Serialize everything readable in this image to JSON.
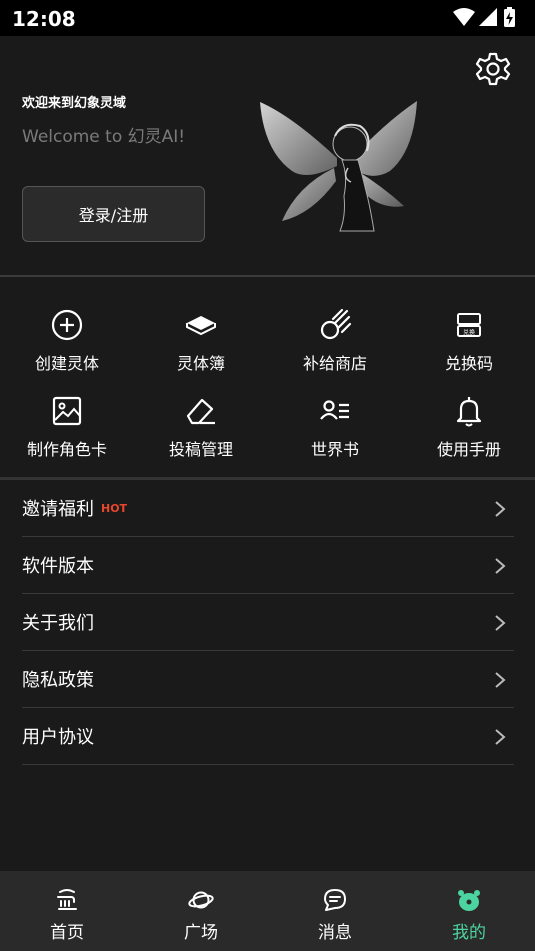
{
  "status_bar": {
    "time": "12:08"
  },
  "profile": {
    "welcome_cn": "欢迎来到幻象灵域",
    "welcome_en": "Welcome to 幻灵AI!",
    "login_label": "登录/注册"
  },
  "grid": {
    "items": [
      {
        "label": "创建灵体",
        "icon": "plus-circle-icon"
      },
      {
        "label": "灵体簿",
        "icon": "book-icon"
      },
      {
        "label": "补给商店",
        "icon": "meteor-icon"
      },
      {
        "label": "兑换码",
        "icon": "redeem-ticket-icon"
      },
      {
        "label": "制作角色卡",
        "icon": "image-card-icon"
      },
      {
        "label": "投稿管理",
        "icon": "eraser-icon"
      },
      {
        "label": "世界书",
        "icon": "user-list-icon"
      },
      {
        "label": "使用手册",
        "icon": "bell-icon"
      }
    ],
    "redeem_icon_text": "兑换"
  },
  "menu": {
    "items": [
      {
        "label": "邀请福利",
        "badge": "HOT"
      },
      {
        "label": "软件版本"
      },
      {
        "label": "关于我们"
      },
      {
        "label": "隐私政策"
      },
      {
        "label": "用户协议"
      }
    ]
  },
  "tabbar": {
    "items": [
      {
        "label": "首页",
        "icon": "home-icon"
      },
      {
        "label": "广场",
        "icon": "planet-icon"
      },
      {
        "label": "消息",
        "icon": "message-icon"
      },
      {
        "label": "我的",
        "icon": "profile-mascot-icon",
        "active": true
      }
    ],
    "active_color": "#4cd4a0"
  },
  "colors": {
    "background": "#1a1a1a",
    "hot": "#e8462c",
    "accent": "#4cd4a0"
  }
}
